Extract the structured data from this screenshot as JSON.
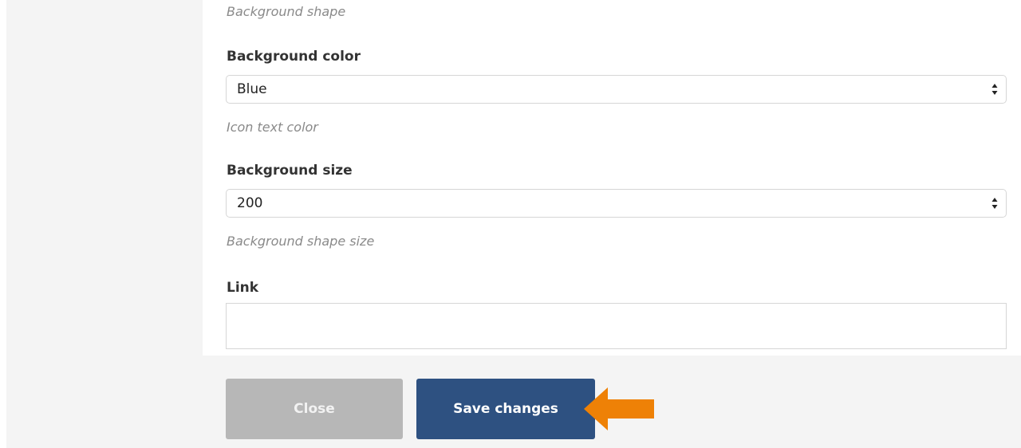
{
  "form": {
    "shape_help": "Background shape",
    "bg_color_label": "Background color",
    "bg_color_value": "Blue",
    "bg_color_help": "Icon text color",
    "bg_size_label": "Background size",
    "bg_size_value": "200",
    "bg_size_help": "Background shape size",
    "link_label": "Link",
    "link_value": ""
  },
  "footer": {
    "close_label": "Close",
    "save_label": "Save changes"
  },
  "colors": {
    "save_button": "#2e5181",
    "close_button": "#b7b7b7",
    "callout_arrow": "#ee8106"
  },
  "icons": {
    "select_arrows": "up-down-caret-icon",
    "callout": "arrow-left-icon"
  }
}
